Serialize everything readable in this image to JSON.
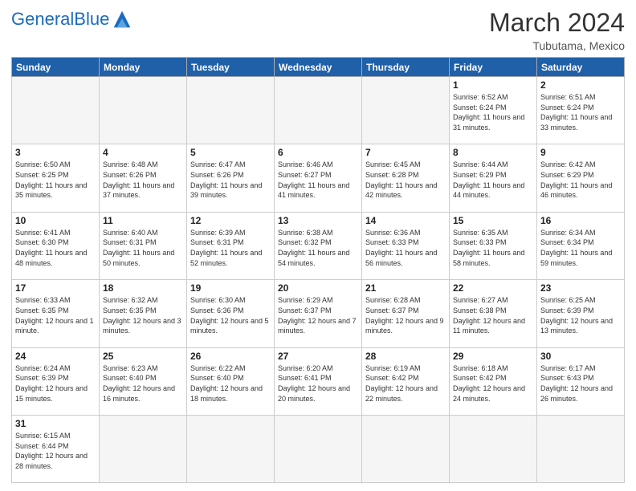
{
  "header": {
    "logo_general": "General",
    "logo_blue": "Blue",
    "month_year": "March 2024",
    "location": "Tubutama, Mexico"
  },
  "days_of_week": [
    "Sunday",
    "Monday",
    "Tuesday",
    "Wednesday",
    "Thursday",
    "Friday",
    "Saturday"
  ],
  "weeks": [
    [
      {
        "day": "",
        "empty": true
      },
      {
        "day": "",
        "empty": true
      },
      {
        "day": "",
        "empty": true
      },
      {
        "day": "",
        "empty": true
      },
      {
        "day": "",
        "empty": true
      },
      {
        "day": "1",
        "sunrise": "6:52 AM",
        "sunset": "6:24 PM",
        "daylight": "11 hours and 31 minutes."
      },
      {
        "day": "2",
        "sunrise": "6:51 AM",
        "sunset": "6:24 PM",
        "daylight": "11 hours and 33 minutes."
      }
    ],
    [
      {
        "day": "3",
        "sunrise": "6:50 AM",
        "sunset": "6:25 PM",
        "daylight": "11 hours and 35 minutes."
      },
      {
        "day": "4",
        "sunrise": "6:48 AM",
        "sunset": "6:26 PM",
        "daylight": "11 hours and 37 minutes."
      },
      {
        "day": "5",
        "sunrise": "6:47 AM",
        "sunset": "6:26 PM",
        "daylight": "11 hours and 39 minutes."
      },
      {
        "day": "6",
        "sunrise": "6:46 AM",
        "sunset": "6:27 PM",
        "daylight": "11 hours and 41 minutes."
      },
      {
        "day": "7",
        "sunrise": "6:45 AM",
        "sunset": "6:28 PM",
        "daylight": "11 hours and 42 minutes."
      },
      {
        "day": "8",
        "sunrise": "6:44 AM",
        "sunset": "6:29 PM",
        "daylight": "11 hours and 44 minutes."
      },
      {
        "day": "9",
        "sunrise": "6:42 AM",
        "sunset": "6:29 PM",
        "daylight": "11 hours and 46 minutes."
      }
    ],
    [
      {
        "day": "10",
        "sunrise": "6:41 AM",
        "sunset": "6:30 PM",
        "daylight": "11 hours and 48 minutes."
      },
      {
        "day": "11",
        "sunrise": "6:40 AM",
        "sunset": "6:31 PM",
        "daylight": "11 hours and 50 minutes."
      },
      {
        "day": "12",
        "sunrise": "6:39 AM",
        "sunset": "6:31 PM",
        "daylight": "11 hours and 52 minutes."
      },
      {
        "day": "13",
        "sunrise": "6:38 AM",
        "sunset": "6:32 PM",
        "daylight": "11 hours and 54 minutes."
      },
      {
        "day": "14",
        "sunrise": "6:36 AM",
        "sunset": "6:33 PM",
        "daylight": "11 hours and 56 minutes."
      },
      {
        "day": "15",
        "sunrise": "6:35 AM",
        "sunset": "6:33 PM",
        "daylight": "11 hours and 58 minutes."
      },
      {
        "day": "16",
        "sunrise": "6:34 AM",
        "sunset": "6:34 PM",
        "daylight": "11 hours and 59 minutes."
      }
    ],
    [
      {
        "day": "17",
        "sunrise": "6:33 AM",
        "sunset": "6:35 PM",
        "daylight": "12 hours and 1 minute."
      },
      {
        "day": "18",
        "sunrise": "6:32 AM",
        "sunset": "6:35 PM",
        "daylight": "12 hours and 3 minutes."
      },
      {
        "day": "19",
        "sunrise": "6:30 AM",
        "sunset": "6:36 PM",
        "daylight": "12 hours and 5 minutes."
      },
      {
        "day": "20",
        "sunrise": "6:29 AM",
        "sunset": "6:37 PM",
        "daylight": "12 hours and 7 minutes."
      },
      {
        "day": "21",
        "sunrise": "6:28 AM",
        "sunset": "6:37 PM",
        "daylight": "12 hours and 9 minutes."
      },
      {
        "day": "22",
        "sunrise": "6:27 AM",
        "sunset": "6:38 PM",
        "daylight": "12 hours and 11 minutes."
      },
      {
        "day": "23",
        "sunrise": "6:25 AM",
        "sunset": "6:39 PM",
        "daylight": "12 hours and 13 minutes."
      }
    ],
    [
      {
        "day": "24",
        "sunrise": "6:24 AM",
        "sunset": "6:39 PM",
        "daylight": "12 hours and 15 minutes."
      },
      {
        "day": "25",
        "sunrise": "6:23 AM",
        "sunset": "6:40 PM",
        "daylight": "12 hours and 16 minutes."
      },
      {
        "day": "26",
        "sunrise": "6:22 AM",
        "sunset": "6:40 PM",
        "daylight": "12 hours and 18 minutes."
      },
      {
        "day": "27",
        "sunrise": "6:20 AM",
        "sunset": "6:41 PM",
        "daylight": "12 hours and 20 minutes."
      },
      {
        "day": "28",
        "sunrise": "6:19 AM",
        "sunset": "6:42 PM",
        "daylight": "12 hours and 22 minutes."
      },
      {
        "day": "29",
        "sunrise": "6:18 AM",
        "sunset": "6:42 PM",
        "daylight": "12 hours and 24 minutes."
      },
      {
        "day": "30",
        "sunrise": "6:17 AM",
        "sunset": "6:43 PM",
        "daylight": "12 hours and 26 minutes."
      }
    ],
    [
      {
        "day": "31",
        "sunrise": "6:15 AM",
        "sunset": "6:44 PM",
        "daylight": "12 hours and 28 minutes.",
        "last": true
      },
      {
        "day": "",
        "empty": true,
        "last": true
      },
      {
        "day": "",
        "empty": true,
        "last": true
      },
      {
        "day": "",
        "empty": true,
        "last": true
      },
      {
        "day": "",
        "empty": true,
        "last": true
      },
      {
        "day": "",
        "empty": true,
        "last": true
      },
      {
        "day": "",
        "empty": true,
        "last": true
      }
    ]
  ]
}
